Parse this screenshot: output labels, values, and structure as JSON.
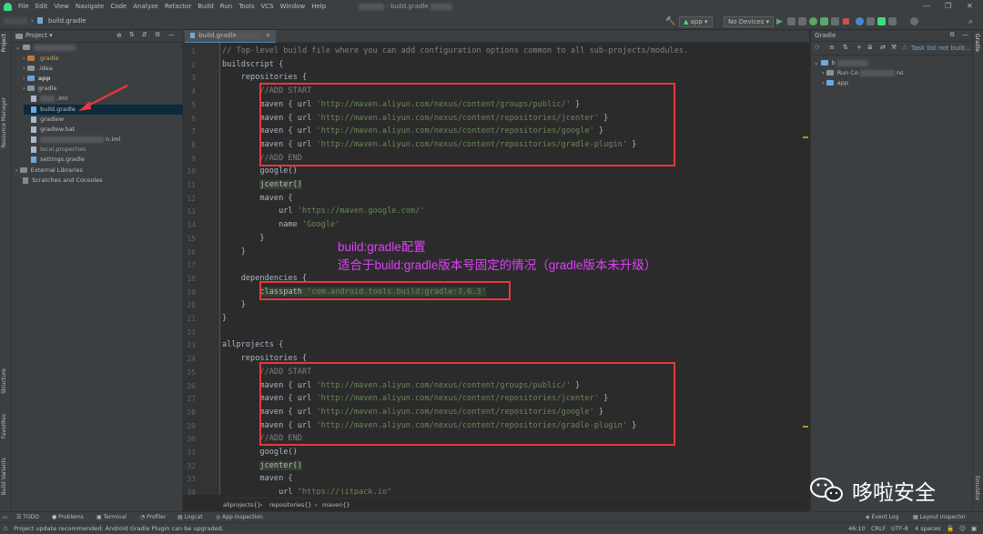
{
  "menu": {
    "items": [
      "File",
      "Edit",
      "View",
      "Navigate",
      "Code",
      "Analyze",
      "Refactor",
      "Build",
      "Run",
      "Tools",
      "VCS",
      "Window",
      "Help"
    ],
    "window_title": "build.gradle"
  },
  "nav": {
    "crumb_file": "build.gradle",
    "run_config": "app",
    "device": "No Devices"
  },
  "left_stripe": {
    "project": "Project",
    "resource_manager": "Resource Manager",
    "structure": "Structure",
    "favorites": "Favorites",
    "build_variants": "Build Variants"
  },
  "project_panel": {
    "header": "Project",
    "tree": [
      {
        "label": ".gradle"
      },
      {
        "label": ".idea"
      },
      {
        "label": "app"
      },
      {
        "label": "gradle"
      },
      {
        "label": ".iml"
      },
      {
        "label": "build.gradle"
      },
      {
        "label": "gradlew"
      },
      {
        "label": "gradlew.bat"
      },
      {
        "label": "n.iml"
      },
      {
        "label": "local.properties"
      },
      {
        "label": "settings.gradle"
      },
      {
        "label": "External Libraries"
      },
      {
        "label": "Scratches and Consoles"
      }
    ]
  },
  "editor": {
    "tab_label": "build.gradle",
    "line_numbers": [
      "1",
      "2",
      "3",
      "4",
      "5",
      "6",
      "7",
      "8",
      "9",
      "10",
      "11",
      "12",
      "13",
      "14",
      "15",
      "16",
      "17",
      "18",
      "19",
      "20",
      "21",
      "22",
      "23",
      "24",
      "25",
      "26",
      "27",
      "28",
      "29",
      "30",
      "31",
      "32",
      "33",
      "34"
    ],
    "lines": [
      "// Top-level build file where you can add configuration options common to all sub-projects/modules.",
      "buildscript {",
      "    repositories {",
      "        //ADD START",
      "        maven { url 'http://maven.aliyun.com/nexus/content/groups/public/' }",
      "        maven { url 'http://maven.aliyun.com/nexus/content/repositories/jcenter' }",
      "        maven { url 'http://maven.aliyun.com/nexus/content/repositories/google' }",
      "        maven { url 'http://maven.aliyun.com/nexus/content/repositories/gradle-plugin' }",
      "        //ADD END",
      "        google()",
      "        jcenter()",
      "        maven {",
      "            url 'https://maven.google.com/'",
      "            name 'Google'",
      "        }",
      "    }",
      "",
      "    dependencies {",
      "        classpath 'com.android.tools.build:gradle:3.6.3'",
      "    }",
      "}",
      "",
      "allprojects {",
      "    repositories {",
      "        //ADD START",
      "        maven { url 'http://maven.aliyun.com/nexus/content/groups/public/' }",
      "        maven { url 'http://maven.aliyun.com/nexus/content/repositories/jcenter' }",
      "        maven { url 'http://maven.aliyun.com/nexus/content/repositories/google' }",
      "        maven { url 'http://maven.aliyun.com/nexus/content/repositories/gradle-plugin' }",
      "        //ADD END",
      "        google()",
      "        jcenter()",
      "        maven {",
      "            url \"https://jitpack.io\""
    ],
    "annotation_line1": "build:gradle配置",
    "annotation_line2": "适合于build:gradle版本号固定的情况（gradle版本未升级）",
    "breadcrumb": [
      "allprojects{}",
      "repositories{}",
      "maven{}"
    ]
  },
  "gradle_panel": {
    "title": "Gradle",
    "task_list": "Task list not built...",
    "root": "b",
    "run_config": "Run Co",
    "run_config_suffix": "ns",
    "app": "app"
  },
  "right_stripe": {
    "gradle": "Gradle",
    "emulator": "Emulator"
  },
  "tool_tabs": {
    "todo": "TODO",
    "problems": "Problems",
    "terminal": "Terminal",
    "profiler": "Profiler",
    "logcat": "Logcat",
    "app_inspection": "App Inspection",
    "event_log": "Event Log",
    "layout_inspector": "Layout Inspector"
  },
  "status": {
    "message": "Project update recommended: Android Gradle Plugin can be upgraded.",
    "position": "46:10",
    "line_sep": "CRLF",
    "encoding": "UTF-8",
    "indent": "4 spaces"
  },
  "watermark": {
    "text": "哆啦安全"
  },
  "colors": {
    "ide_bg": "#2b2b2b",
    "panel_bg": "#3c3f41",
    "highlight_box": "#e8383d",
    "annotation": "#e040fb",
    "string": "#6a8759",
    "comment": "#808080"
  }
}
